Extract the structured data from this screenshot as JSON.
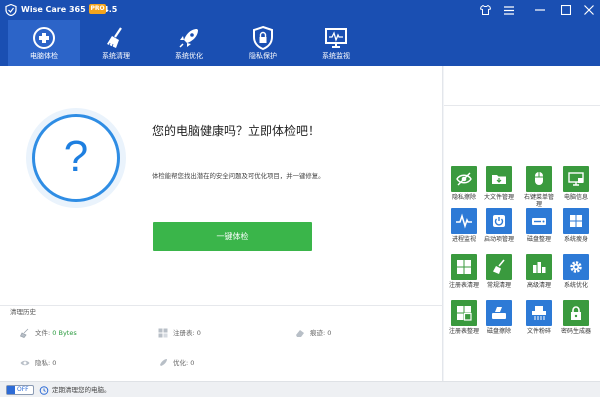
{
  "titlebar": {
    "title": "Wise Care 365 - 5.4.5",
    "badge": "PRO"
  },
  "nav": [
    {
      "label": "电脑体检",
      "icon": "stethoscope-icon",
      "active": true
    },
    {
      "label": "系统清理",
      "icon": "broom-icon",
      "active": false
    },
    {
      "label": "系统优化",
      "icon": "rocket-icon",
      "active": false
    },
    {
      "label": "隐私保护",
      "icon": "shield-lock-icon",
      "active": false
    },
    {
      "label": "系统监视",
      "icon": "monitor-icon",
      "active": false
    }
  ],
  "main": {
    "question_mark": "?",
    "headline": "您的电脑健康吗？立即体检吧！",
    "description": "体检能帮您找出潜在的安全问题及可优化项目，并一键修复。",
    "check_button": "一键体检"
  },
  "history": {
    "title": "清理历史",
    "files_label": "文件:",
    "files_value": "0 Bytes",
    "registry_label": "注册表:",
    "registry_value": "0",
    "traces_label": "痕迹:",
    "traces_value": "0",
    "privacy_label": "隐私:",
    "privacy_value": "0",
    "optimize_label": "优化:",
    "optimize_value": "0"
  },
  "tools": [
    {
      "label": "隐私擦除",
      "icon": "eye-slash-icon",
      "color": "#3a9a3e"
    },
    {
      "label": "大文件管理",
      "icon": "folder-icon",
      "color": "#3a9a3e"
    },
    {
      "label": "右键菜单管理",
      "icon": "mouse-icon",
      "color": "#3a9a3e"
    },
    {
      "label": "电脑信息",
      "icon": "pc-info-icon",
      "color": "#3a9a3e"
    },
    {
      "label": "进程监视",
      "icon": "pulse-icon",
      "color": "#2d7ad6"
    },
    {
      "label": "启动项管理",
      "icon": "power-icon",
      "color": "#2d7ad6"
    },
    {
      "label": "磁盘整理",
      "icon": "disk-defrag-icon",
      "color": "#2d7ad6"
    },
    {
      "label": "系统瘦身",
      "icon": "windows-icon",
      "color": "#2d7ad6"
    },
    {
      "label": "注册表清理",
      "icon": "registry-icon",
      "color": "#3a9a3e"
    },
    {
      "label": "常规清理",
      "icon": "broom-tile-icon",
      "color": "#3a9a3e"
    },
    {
      "label": "高级清理",
      "icon": "bottles-icon",
      "color": "#3a9a3e"
    },
    {
      "label": "系统优化",
      "icon": "gear-icon",
      "color": "#2d7ad6"
    },
    {
      "label": "注册表整理",
      "icon": "registry-defrag-icon",
      "color": "#3a9a3e"
    },
    {
      "label": "磁盘擦除",
      "icon": "disk-erase-icon",
      "color": "#2d7ad6"
    },
    {
      "label": "文件粉碎",
      "icon": "shredder-icon",
      "color": "#2d7ad6"
    },
    {
      "label": "密码生成器",
      "icon": "lock-icon",
      "color": "#3a9a3e"
    }
  ],
  "statusbar": {
    "toggle_text": "OFF",
    "message": "定期清理您的电脑。"
  },
  "colors": {
    "header": "#1a4fb2",
    "nav_active": "#2c64c8",
    "accent_blue": "#1e7fe0",
    "button_green": "#3ab54a",
    "badge_orange": "#f4a41c"
  }
}
